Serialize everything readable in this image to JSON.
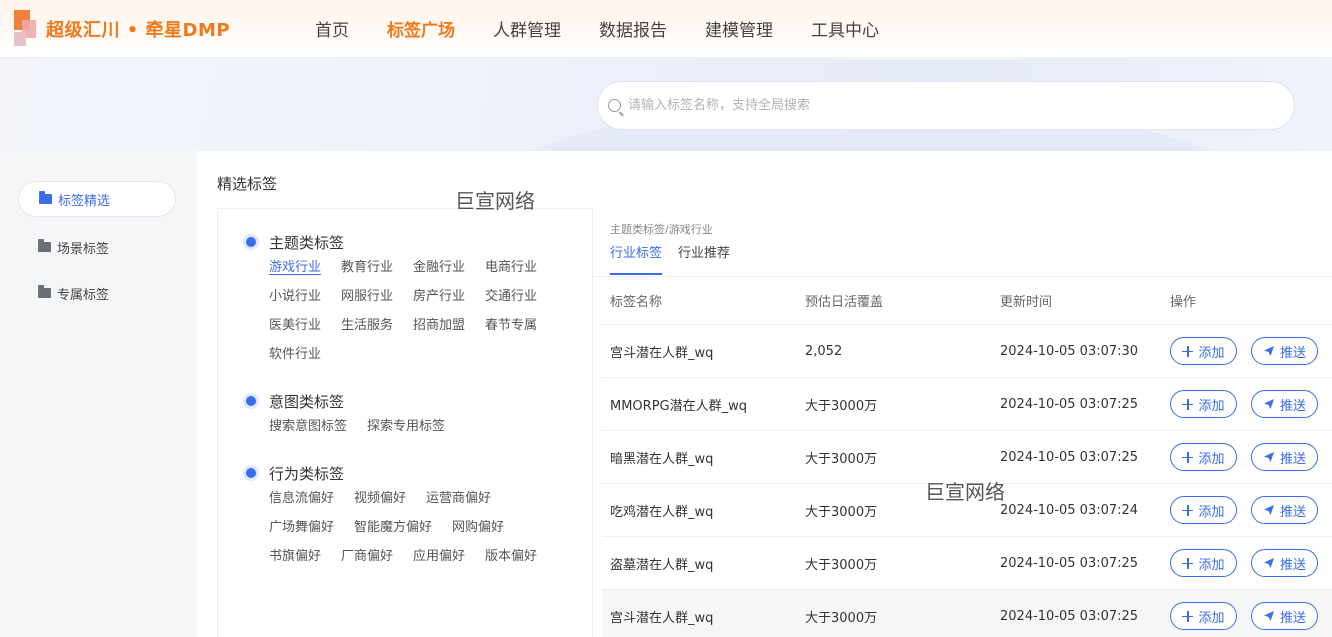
{
  "header": {
    "logo_text": "超级汇川 • 牵星DMP",
    "nav": [
      {
        "label": "首页",
        "active": false
      },
      {
        "label": "标签广场",
        "active": true
      },
      {
        "label": "人群管理",
        "active": false
      },
      {
        "label": "数据报告",
        "active": false
      },
      {
        "label": "建模管理",
        "active": false
      },
      {
        "label": "工具中心",
        "active": false
      }
    ]
  },
  "search": {
    "placeholder": "请输入标签名称，支持全局搜索",
    "value": ""
  },
  "sidebar": {
    "items": [
      {
        "label": "标签精选",
        "icon": "folder-icon",
        "active": true
      },
      {
        "label": "场景标签",
        "icon": "folder-icon",
        "active": false
      },
      {
        "label": "专属标签",
        "icon": "folder-icon",
        "active": false
      }
    ]
  },
  "main": {
    "title": "精选标签",
    "watermarks": [
      "巨宣网络",
      "巨宣网络"
    ]
  },
  "categories": [
    {
      "title": "主题类标签",
      "tags": [
        "游戏行业",
        "教育行业",
        "金融行业",
        "电商行业",
        "小说行业",
        "网服行业",
        "房产行业",
        "交通行业",
        "医美行业",
        "生活服务",
        "招商加盟",
        "春节专属",
        "软件行业"
      ],
      "active_tag": "游戏行业"
    },
    {
      "title": "意图类标签",
      "tags": [
        "搜索意图标签",
        "探索专用标签"
      ],
      "active_tag": ""
    },
    {
      "title": "行为类标签",
      "tags": [
        "信息流偏好",
        "视频偏好",
        "运营商偏好",
        "广场舞偏好",
        "智能魔方偏好",
        "网购偏好",
        "书旗偏好",
        "厂商偏好",
        "应用偏好",
        "版本偏好"
      ],
      "active_tag": ""
    }
  ],
  "detail": {
    "breadcrumb": "主题类标签/游戏行业",
    "tabs": [
      {
        "label": "行业标签",
        "active": true
      },
      {
        "label": "行业推荐",
        "active": false
      }
    ],
    "table": {
      "columns": [
        "标签名称",
        "预估日活覆盖",
        "更新时间",
        "操作"
      ],
      "add_label": "添加",
      "push_label": "推送",
      "rows": [
        {
          "name": "宫斗潜在人群_wq",
          "coverage": "2,052",
          "updated": "2024-10-05 03:07:30"
        },
        {
          "name": "MMORPG潜在人群_wq",
          "coverage": "大于3000万",
          "updated": "2024-10-05 03:07:25"
        },
        {
          "name": "暗黑潜在人群_wq",
          "coverage": "大于3000万",
          "updated": "2024-10-05 03:07:25"
        },
        {
          "name": "吃鸡潜在人群_wq",
          "coverage": "大于3000万",
          "updated": "2024-10-05 03:07:24"
        },
        {
          "name": "盗墓潜在人群_wq",
          "coverage": "大于3000万",
          "updated": "2024-10-05 03:07:25"
        },
        {
          "name": "宫斗潜在人群_wq",
          "coverage": "大于3000万",
          "updated": "2024-10-05 03:07:25"
        }
      ]
    }
  },
  "colors": {
    "brand_orange": "#f07a1a",
    "accent_blue": "#3a6ee8"
  }
}
